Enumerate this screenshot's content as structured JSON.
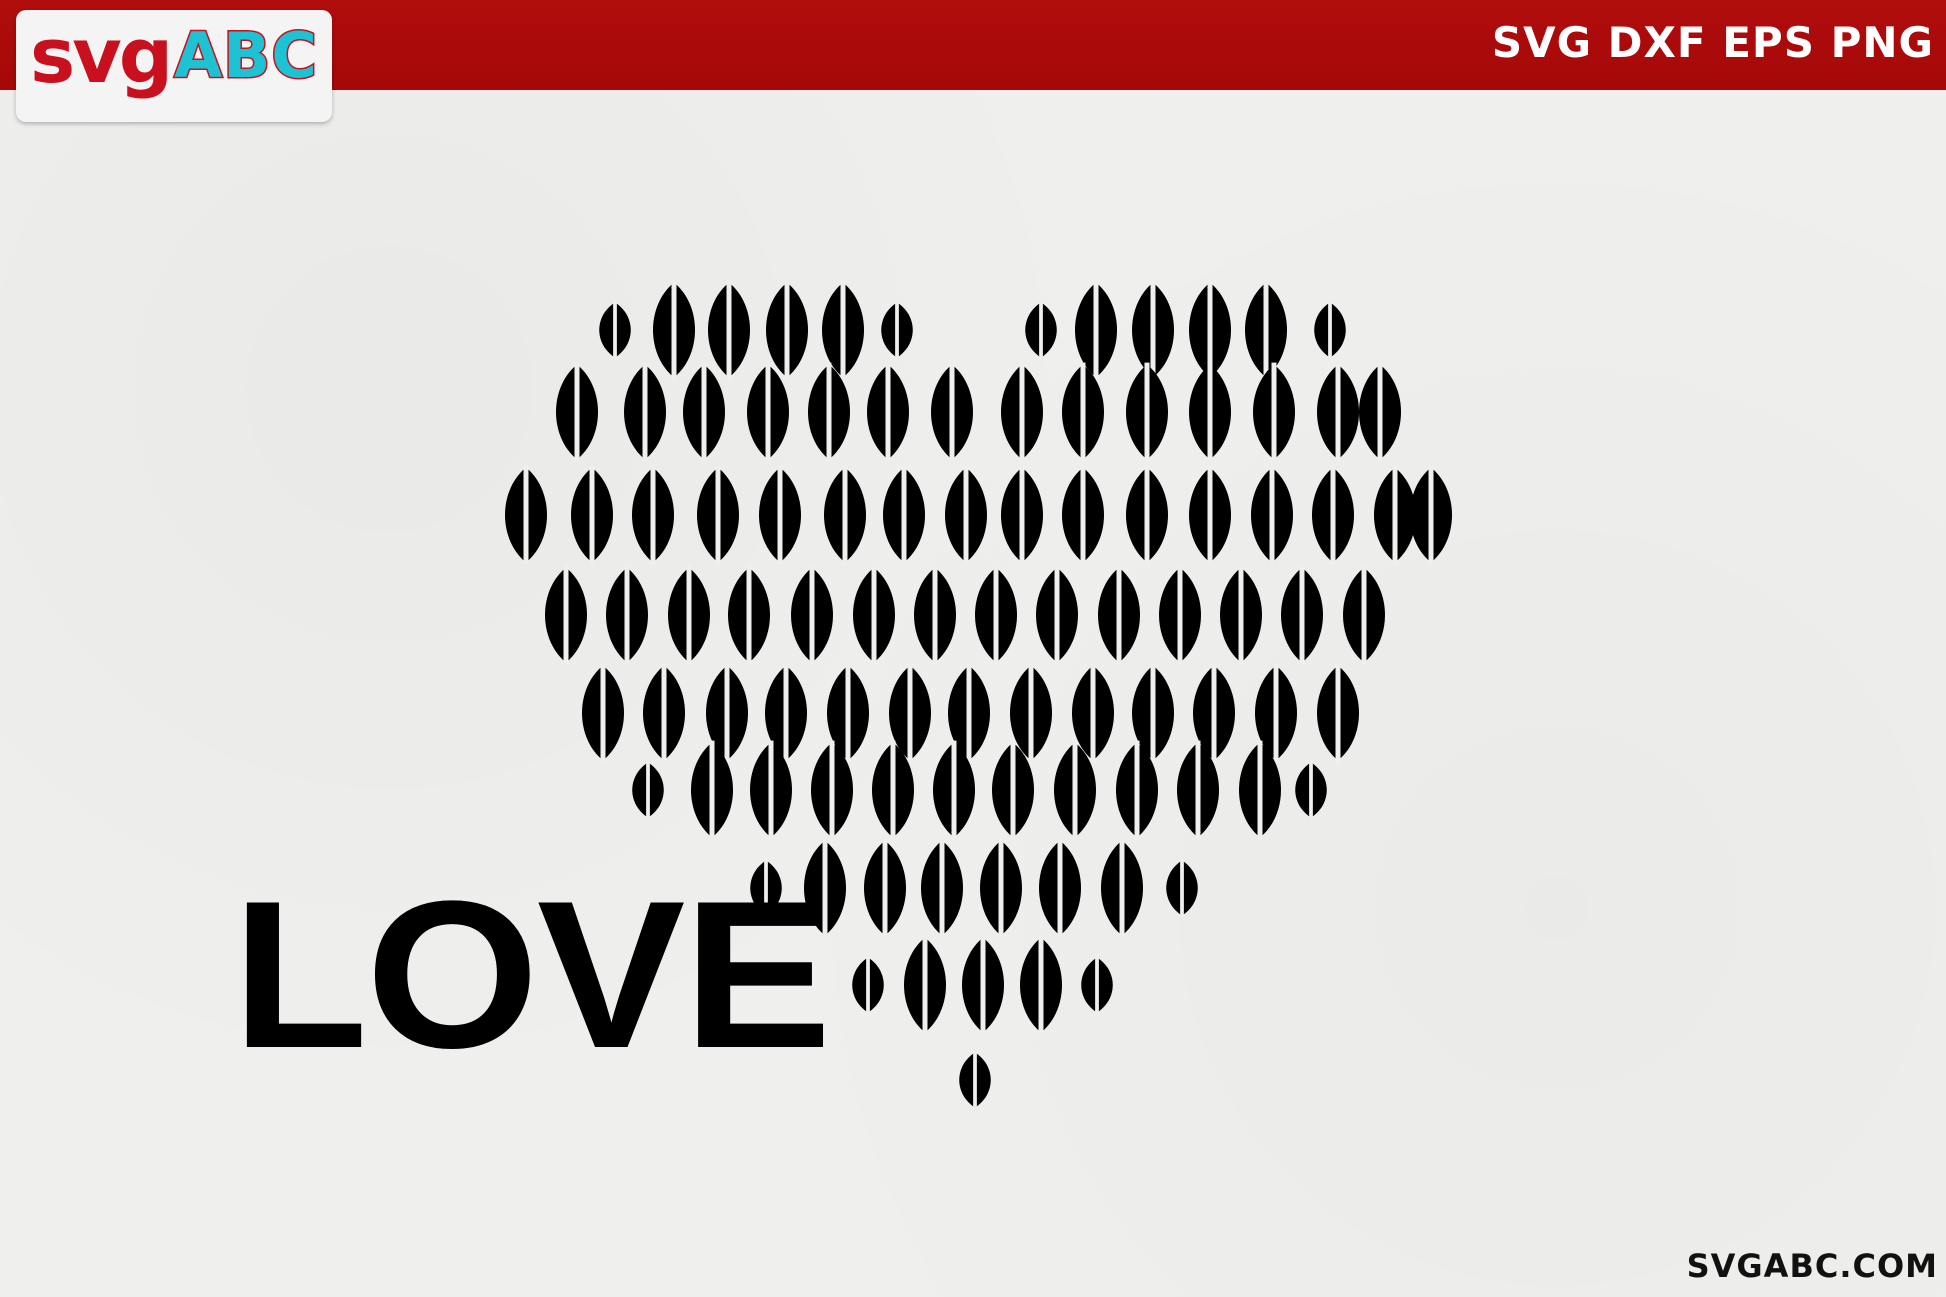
{
  "brand": {
    "part1": "svg",
    "part2": "ABC"
  },
  "formats": "SVG DXF EPS PNG",
  "design": {
    "word": "LOVE",
    "icon": "striped-heart-icon",
    "fill_color": "#000000"
  },
  "footer": {
    "url": "SVGABC.COM"
  },
  "colors": {
    "banner": "#a80a0a",
    "logo_red": "#c8101e",
    "logo_cyan": "#1dc2d3",
    "paper": "#efefed"
  }
}
